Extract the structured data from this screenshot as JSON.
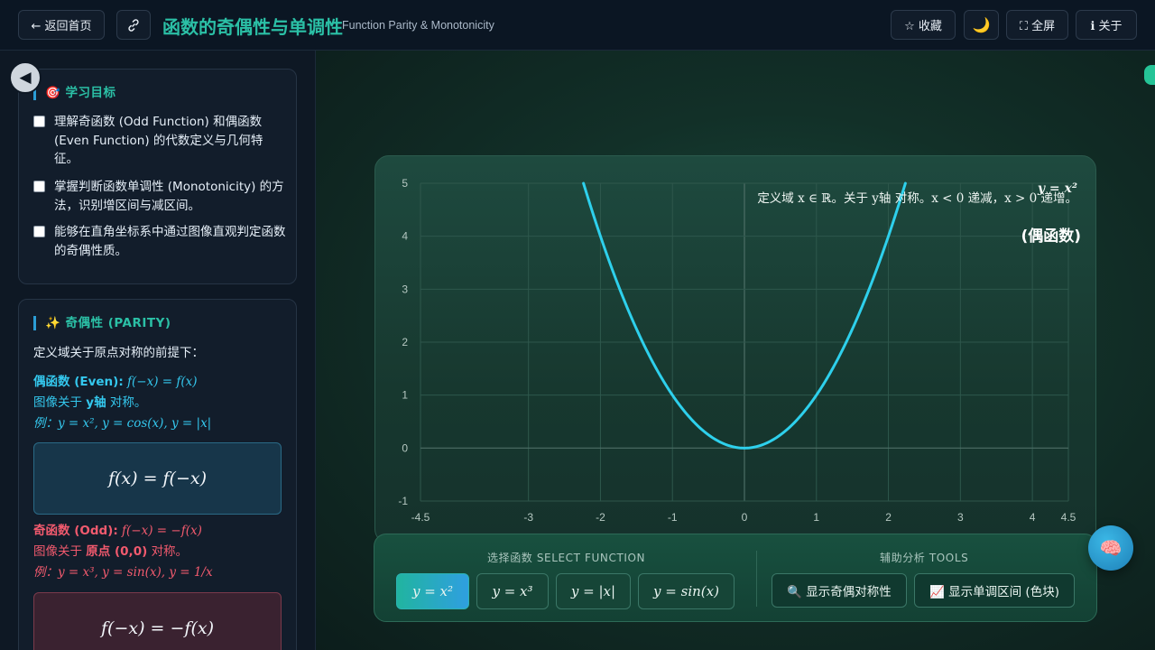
{
  "header": {
    "back_label": "← 返回首页",
    "link_icon": "link-icon",
    "title": "函数的奇偶性与单调性",
    "subtitle": "Function Parity & Monotonicity",
    "favorite_label": "☆ 收藏",
    "theme_icon": "🌙",
    "fullscreen_label": "⛶ 全屏",
    "about_label": "ℹ 关于"
  },
  "sidebar": {
    "collapse_icon": "◀",
    "goals": {
      "title": "🎯 学习目标",
      "items": [
        "理解奇函数 (Odd Function) 和偶函数 (Even Function) 的代数定义与几何特征。",
        "掌握判断函数单调性 (Monotonicity) 的方法，识别增区间与减区间。",
        "能够在直角坐标系中通过图像直观判定函数的奇偶性质。"
      ]
    },
    "parity": {
      "title": "✨ 奇偶性 (PARITY)",
      "intro": "定义域关于原点对称的前提下：",
      "even_label": "偶函数 (Even):",
      "even_formula": "f(−x) = f(x)",
      "even_desc_pre": "图像关于",
      "even_desc_key": "y轴",
      "even_desc_post": "对称。",
      "even_examples": "例：y = x², y = cos(x), y = |x|",
      "even_box": "f(x) = f(−x)",
      "odd_label": "奇函数 (Odd):",
      "odd_formula": "f(−x) = −f(x)",
      "odd_desc_pre": "图像关于",
      "odd_desc_key": "原点 (0,0)",
      "odd_desc_post": "对称。",
      "odd_examples": "例：y = x³, y = sin(x), y = 1/x",
      "odd_box": "f(−x) = −f(x)"
    }
  },
  "chart_data": {
    "type": "line",
    "function": "y = x^2",
    "x_ticks": [
      "-4.5",
      "-3",
      "-2",
      "-1",
      "0",
      "1",
      "2",
      "3",
      "4",
      "4.5"
    ],
    "y_ticks": [
      "-1",
      "0",
      "1",
      "2",
      "3",
      "4",
      "5"
    ],
    "xlim": [
      -4.5,
      4.5
    ],
    "ylim": [
      -1,
      5
    ],
    "grid": true,
    "series_color": "#2ed0ec",
    "annotation_line": "定义域 x ∈ ℝ。关于 y轴 对称。x < 0 递减，x > 0 递增。",
    "annotation_tag": "(偶函数)",
    "overlay_label": "y = x²"
  },
  "controls": {
    "select_label": "选择函数 SELECT FUNCTION",
    "functions": [
      "y = x²",
      "y = x³",
      "y = |x|",
      "y = sin(x)"
    ],
    "tools_label": "辅助分析 TOOLS",
    "tool_parity": "🔍 显示奇偶对称性",
    "tool_mono": "📈 显示单调区间 (色块)",
    "assistant_icon": "🧠"
  }
}
